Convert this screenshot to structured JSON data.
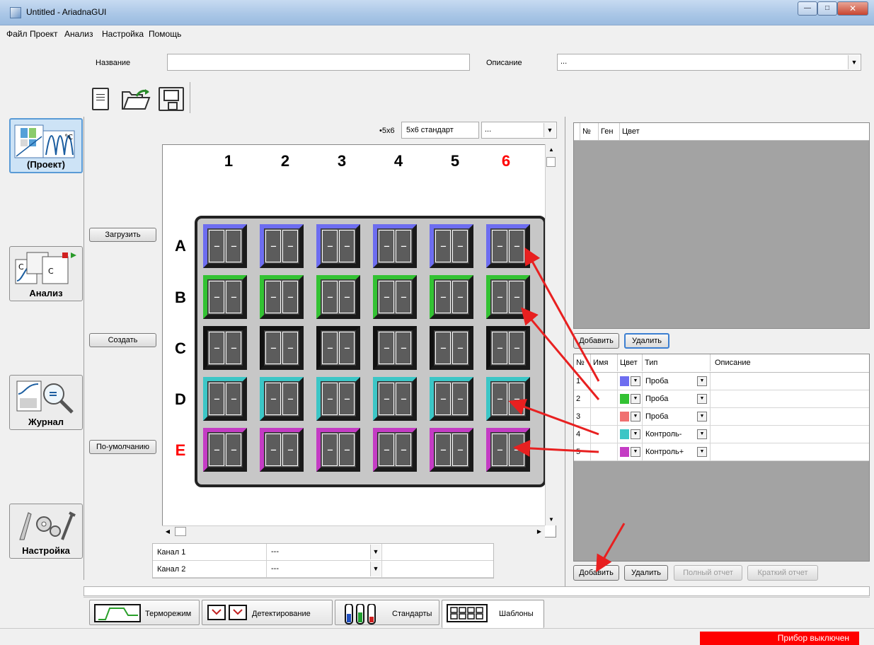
{
  "window": {
    "title": "Untitled - AriadnaGUI"
  },
  "menu": [
    "Файл",
    "Проект",
    "Анализ",
    "Настройка",
    "Помощь"
  ],
  "header": {
    "name_label": "Название",
    "name_value": "",
    "desc_label": "Описание",
    "desc_value": "..."
  },
  "nav": {
    "project": "(Проект)",
    "analysis": "Анализ",
    "journal": "Журнал",
    "settings": "Настройка"
  },
  "side_buttons": {
    "load": "Загрузить",
    "create": "Создать",
    "default": "По-умолчанию"
  },
  "template": {
    "prefix": "•5x6",
    "code": "5x6 стандарт",
    "select": "..."
  },
  "plate": {
    "columns": [
      "1",
      "2",
      "3",
      "4",
      "5",
      "6"
    ],
    "rows": [
      "A",
      "B",
      "C",
      "D",
      "E"
    ],
    "highlight_color": "#ff0000",
    "row_colors": [
      "#6d6df0",
      "#33c233",
      "#111111",
      "#3cc6c6",
      "#c43cc4"
    ],
    "well_text": "---"
  },
  "channels": [
    {
      "name": "Канал 1",
      "value": "---"
    },
    {
      "name": "Канал 2",
      "value": "---"
    }
  ],
  "genes_table": {
    "headers": [
      "№",
      "Ген",
      "Цвет"
    ],
    "add_label": "Добавить",
    "delete_label": "Удалить"
  },
  "samples_table": {
    "headers": [
      "№",
      "Имя",
      "Цвет",
      "Тип",
      "Описание"
    ],
    "rows": [
      {
        "num": "1",
        "name": "",
        "color": "#6d6df0",
        "type": "Проба",
        "desc": ""
      },
      {
        "num": "2",
        "name": "",
        "color": "#33c233",
        "type": "Проба",
        "desc": ""
      },
      {
        "num": "3",
        "name": "",
        "color": "#f07070",
        "type": "Проба",
        "desc": ""
      },
      {
        "num": "4",
        "name": "",
        "color": "#3cc6c6",
        "type": "Контроль-",
        "desc": ""
      },
      {
        "num": "5",
        "name": "",
        "color": "#c43cc4",
        "type": "Контроль+",
        "desc": ""
      }
    ],
    "add_label": "Добавить",
    "delete_label": "Удалить",
    "full_report_label": "Полный отчет",
    "short_report_label": "Краткий отчет"
  },
  "bottom_tabs": [
    "Терморежим",
    "Детектирование",
    "Стандарты",
    "Шаблоны"
  ],
  "status": {
    "device": "Прибор выключен"
  }
}
